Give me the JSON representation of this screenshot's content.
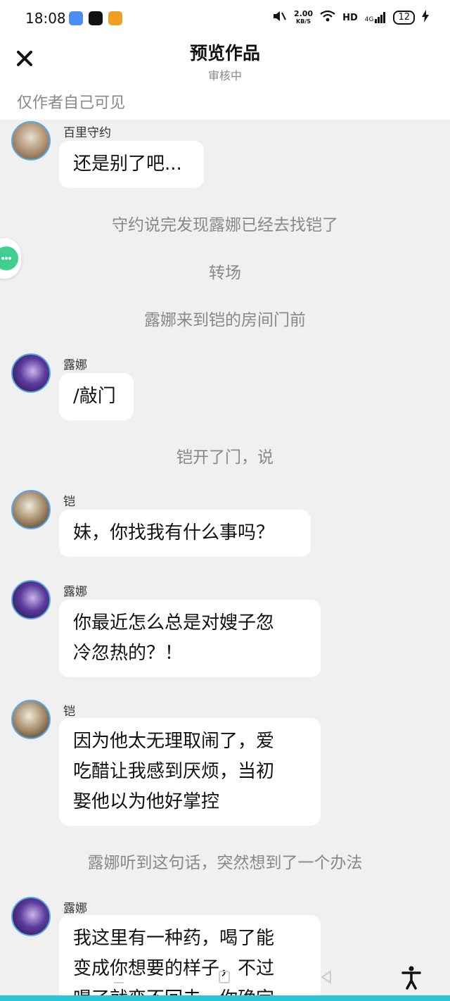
{
  "status": {
    "time": "18:08",
    "speed_value": "2.00",
    "speed_unit": "KB/S",
    "network": "HD",
    "cell": "4G",
    "battery": "12"
  },
  "header": {
    "title": "预览作品",
    "subtitle": "审核中",
    "visibility": "仅作者自己可见"
  },
  "messages": [
    {
      "sender": "百里守约",
      "lines": [
        "还是别了吧..."
      ]
    },
    {
      "sender": "露娜",
      "lines": [
        "/敲门"
      ]
    },
    {
      "sender": "铠",
      "lines": [
        "妹，你找我有什么事吗？"
      ]
    },
    {
      "sender": "露娜",
      "lines": [
        "你最近怎么总是对嫂子忽",
        "冷忽热的？！"
      ]
    },
    {
      "sender": "铠",
      "lines": [
        "因为他太无理取闹了，爱",
        "吃醋让我感到厌烦，当初",
        "娶他以为他好掌控"
      ]
    },
    {
      "sender": "露娜",
      "lines": [
        "我这里有一种药，喝了能",
        "变成你想要的样子，不过",
        "喝了就变不回去，你确定"
      ]
    }
  ],
  "narrations": [
    "守约说完发现露娜已经去找铠了",
    "转场",
    "露娜来到铠的房间门前",
    "铠开了门，说",
    "露娜听到这句话，突然想到了一个办法"
  ],
  "colors": {
    "accent": "#5aa8e6",
    "background": "#f0f0f0",
    "bottom_bar": "#2fc4d6"
  }
}
